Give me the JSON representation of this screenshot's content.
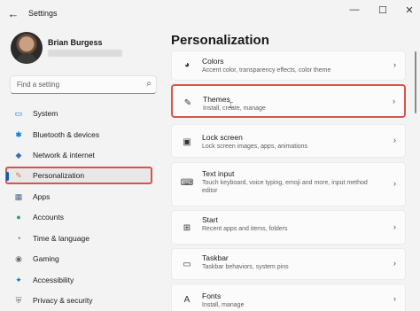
{
  "window": {
    "title": "Settings",
    "back_glyph": "←",
    "min_glyph": "—",
    "max_glyph": "☐",
    "close_glyph": "✕"
  },
  "profile": {
    "name": "Brian Burgess"
  },
  "search": {
    "placeholder": "Find a setting"
  },
  "nav": [
    {
      "label": "System",
      "icon": "monitor-icon",
      "glyph": "▭",
      "color": "#0078d4"
    },
    {
      "label": "Bluetooth & devices",
      "icon": "bluetooth-icon",
      "glyph": "✱",
      "color": "#0078d4"
    },
    {
      "label": "Network & internet",
      "icon": "wifi-icon",
      "glyph": "◆",
      "color": "#3b6fb6"
    },
    {
      "label": "Personalization",
      "icon": "brush-icon",
      "glyph": "✎",
      "color": "#e07b39",
      "selected": true
    },
    {
      "label": "Apps",
      "icon": "apps-icon",
      "glyph": "▦",
      "color": "#4a6b8a"
    },
    {
      "label": "Accounts",
      "icon": "person-icon",
      "glyph": "●",
      "color": "#2e9e5b"
    },
    {
      "label": "Time & language",
      "icon": "globe-clock-icon",
      "glyph": "◔",
      "color": "#0078d4"
    },
    {
      "label": "Gaming",
      "icon": "controller-icon",
      "glyph": "◉",
      "color": "#6b6b6b"
    },
    {
      "label": "Accessibility",
      "icon": "accessibility-icon",
      "glyph": "✦",
      "color": "#0078d4"
    },
    {
      "label": "Privacy & security",
      "icon": "shield-icon",
      "glyph": "⛨",
      "color": "#6b6b6b"
    }
  ],
  "main": {
    "title": "Personalization",
    "cards": [
      {
        "title": "Colors",
        "desc": "Accent color, transparency effects, color theme",
        "icon": "palette-icon",
        "glyph": "◕"
      },
      {
        "title": "Themes",
        "desc": "Install, create, manage",
        "icon": "pen-icon",
        "glyph": "✎",
        "highlight": true
      },
      {
        "title": "Lock screen",
        "desc": "Lock screen images, apps, animations",
        "icon": "lock-screen-icon",
        "glyph": "▣"
      },
      {
        "title": "Text input",
        "desc": "Touch keyboard, voice typing, emoji and more, input method editor",
        "icon": "keyboard-icon",
        "glyph": "⌨"
      },
      {
        "title": "Start",
        "desc": "Recent apps and items, folders",
        "icon": "start-icon",
        "glyph": "⊞"
      },
      {
        "title": "Taskbar",
        "desc": "Taskbar behaviors, system pins",
        "icon": "taskbar-icon",
        "glyph": "▭"
      },
      {
        "title": "Fonts",
        "desc": "Install, manage",
        "icon": "fonts-icon",
        "glyph": "A"
      }
    ],
    "chevron": "›"
  }
}
